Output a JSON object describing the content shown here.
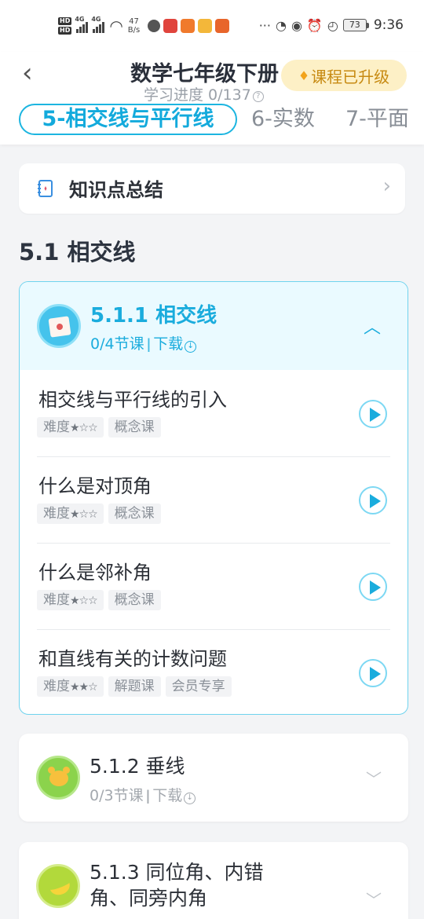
{
  "status_bar": {
    "net1": "4G",
    "net2": "4G",
    "speed_value": "47",
    "speed_unit": "B/s",
    "battery": "73",
    "time": "9:36"
  },
  "header": {
    "title": "数学七年级下册",
    "progress_label": "学习进度 0/137",
    "upgrade_label": "课程已升级",
    "tabs": [
      {
        "label": "5-相交线与平行线",
        "active": true
      },
      {
        "label": "6-实数",
        "active": false
      },
      {
        "label": "7-平面",
        "active": false
      }
    ]
  },
  "summary": {
    "label": "知识点总结"
  },
  "section": {
    "title": "5.1 相交线"
  },
  "units": [
    {
      "title": "5.1.1 相交线",
      "lessons_progress": "0/4节课",
      "download_label": "下载",
      "expanded": true,
      "lessons": [
        {
          "name": "相交线与平行线的引入",
          "difficulty_label": "难度",
          "stars": "★☆☆",
          "tags": [
            "概念课"
          ]
        },
        {
          "name": "什么是对顶角",
          "difficulty_label": "难度",
          "stars": "★☆☆",
          "tags": [
            "概念课"
          ]
        },
        {
          "name": "什么是邻补角",
          "difficulty_label": "难度",
          "stars": "★☆☆",
          "tags": [
            "概念课"
          ]
        },
        {
          "name": "和直线有关的计数问题",
          "difficulty_label": "难度",
          "stars": "★★☆",
          "tags": [
            "解题课",
            "会员专享"
          ]
        }
      ]
    },
    {
      "title": "5.1.2 垂线",
      "lessons_progress": "0/3节课",
      "download_label": "下载",
      "expanded": false
    },
    {
      "title": "5.1.3 同位角、内错角、同旁内角",
      "expanded": false
    }
  ],
  "colors": {
    "accent": "#1aacdd",
    "upgrade_bg": "#fdf0c6",
    "upgrade_text": "#c78a12",
    "page_bg": "#f3f4f6"
  }
}
